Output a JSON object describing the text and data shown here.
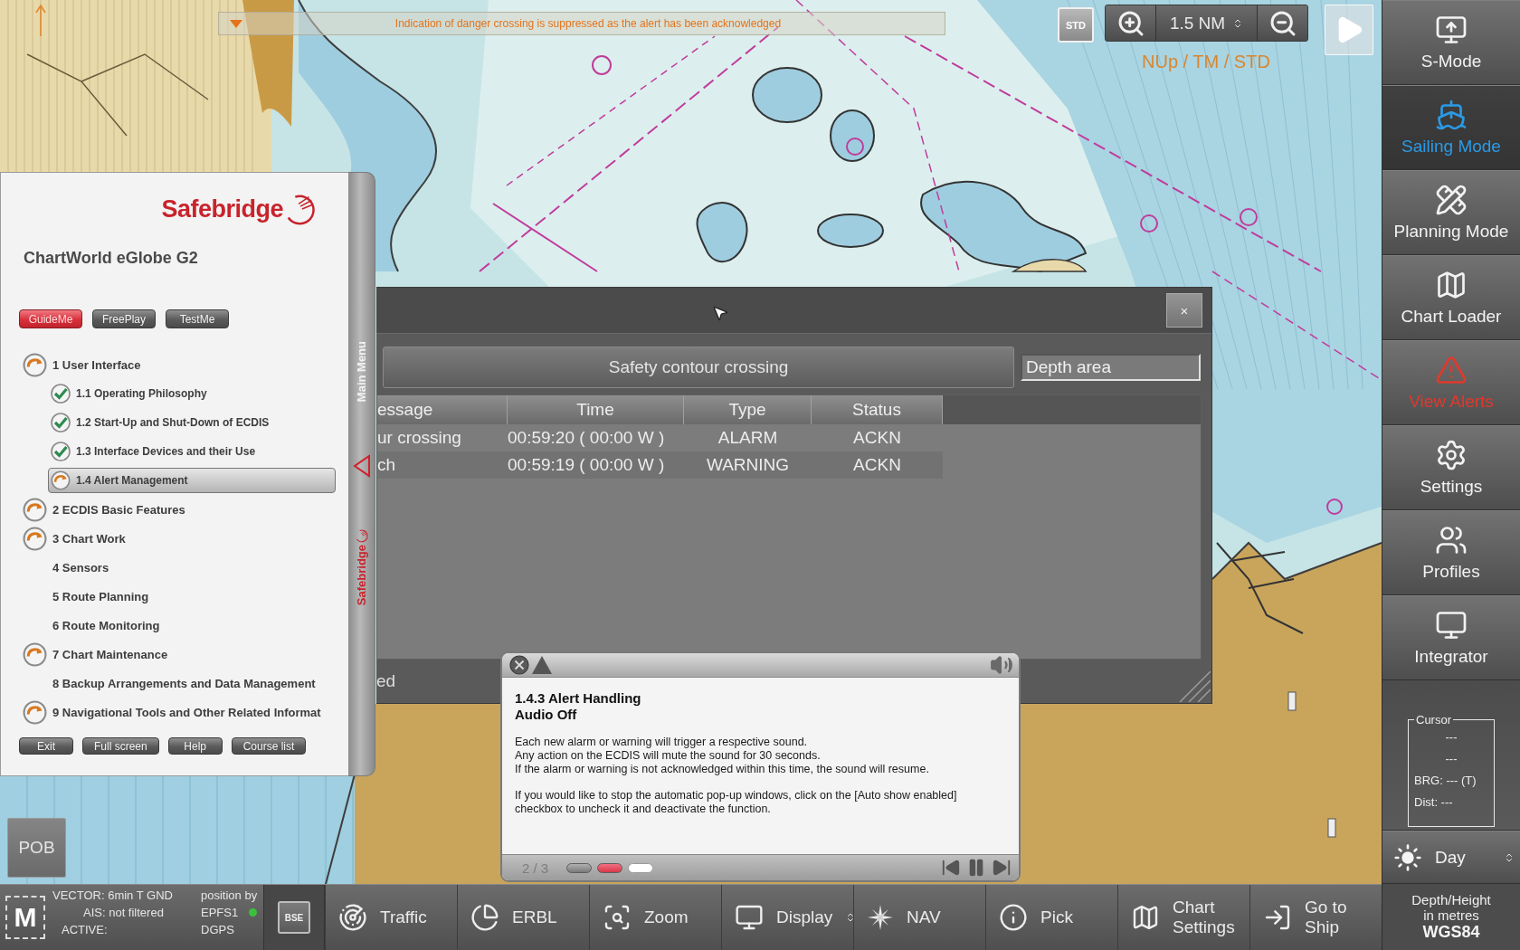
{
  "chart": {
    "banner": {
      "text": "Indication of danger crossing is suppressed as the alert has been acknowledged"
    },
    "std_button": {
      "label": "STD"
    },
    "range": {
      "value": "1.5 NM"
    },
    "orientation": "NUp / TM / STD",
    "pob_button": {
      "label": "POB"
    }
  },
  "sidebar": {
    "items": [
      {
        "label": "S-Mode",
        "selected": false,
        "alert": false
      },
      {
        "label": "Sailing Mode",
        "selected": true,
        "alert": false
      },
      {
        "label": "Planning Mode",
        "selected": false,
        "alert": false
      },
      {
        "label": "Chart Loader",
        "selected": false,
        "alert": false
      },
      {
        "label": "View Alerts",
        "selected": false,
        "alert": true
      },
      {
        "label": "Settings",
        "selected": false,
        "alert": false
      },
      {
        "label": "Profiles",
        "selected": false,
        "alert": false
      },
      {
        "label": "Integrator",
        "selected": false,
        "alert": false
      }
    ],
    "cursor": {
      "legend": "Cursor",
      "position": [
        "---",
        "---"
      ],
      "readouts": [
        "BRG: --- (T)",
        "Dist: ---"
      ]
    },
    "day_mode": {
      "value": "Day"
    },
    "datum": {
      "lines": [
        "Depth/Height",
        "in metres"
      ],
      "name": "WGS84"
    }
  },
  "course_panel": {
    "brand": "Safebridge",
    "product": "ChartWorld eGlobe G2",
    "modes": [
      {
        "label": "GuideMe",
        "selected": true
      },
      {
        "label": "FreePlay",
        "selected": false
      },
      {
        "label": "TestMe",
        "selected": false
      }
    ],
    "chapters": [
      {
        "label": "1 User Interface",
        "kind": "started",
        "selected": false,
        "children": [
          {
            "label": "1.1 Operating Philosophy",
            "kind": "completed",
            "selected": false
          },
          {
            "label": "1.2 Start-Up and Shut-Down of ECDIS",
            "kind": "completed",
            "selected": false
          },
          {
            "label": "1.3 Interface Devices and their Use",
            "kind": "completed",
            "selected": false
          },
          {
            "label": "1.4 Alert Management",
            "kind": "started",
            "selected": true
          }
        ]
      },
      {
        "label": "2 ECDIS Basic Features",
        "kind": "started",
        "selected": false
      },
      {
        "label": "3 Chart Work",
        "kind": "started",
        "selected": false
      },
      {
        "label": "4 Sensors",
        "kind": "unstarted",
        "selected": false
      },
      {
        "label": "5 Route Planning",
        "kind": "unstarted",
        "selected": false
      },
      {
        "label": "6 Route Monitoring",
        "kind": "unstarted",
        "selected": false
      },
      {
        "label": "7 Chart Maintenance",
        "kind": "started",
        "selected": false
      },
      {
        "label": "8 Backup Arrangements and Data Management",
        "kind": "unstarted",
        "selected": false
      },
      {
        "label": "9 Navigational Tools and Other Related Informat",
        "kind": "started",
        "selected": false
      }
    ],
    "buttons": [
      "Exit",
      "Full screen",
      "Help",
      "Course list"
    ],
    "side_tab": {
      "label": "Main Menu",
      "brand": "Safebridge"
    }
  },
  "alert_dialog": {
    "close_label": "×",
    "alert_button": "Safety contour crossing",
    "category_field": {
      "value": "Depth area"
    },
    "columns": [
      "essage",
      "Time",
      "Type",
      "Status"
    ],
    "rows": [
      [
        "ur crossing",
        "00:59:20 ( 00:00 W )",
        "ALARM",
        "ACKN"
      ],
      [
        "ch",
        "00:59:19 ( 00:00 W )",
        "WARNING",
        "ACKN"
      ]
    ],
    "footer": "ed"
  },
  "lesson_popup": {
    "title": "1.4.3 Alert Handling",
    "subtitle": "Audio Off",
    "paragraphs": [
      "Each new alarm or warning will trigger a respective sound.\nAny action on the ECDIS will mute the sound for 30 seconds.\nIf the alarm or warning is not acknowledged within this time, the sound will resume.",
      "If you would like to stop the automatic pop-up windows, click on the [Auto show enabled]\ncheckbox to uncheck it and deactivate the function."
    ],
    "page": "2 / 3",
    "steps": [
      {
        "visited": true,
        "selected": false
      },
      {
        "visited": true,
        "selected": true
      },
      {
        "visited": false,
        "selected": false
      }
    ]
  },
  "status_bar": {
    "mode_button": "M",
    "vector": [
      "VECTOR: 6min T GND",
      "AIS: not filtered",
      "ACTIVE:"
    ],
    "position": {
      "label": "position by",
      "sensor": {
        "name": "EPFS1",
        "color": "#3cc03c"
      },
      "fix": "DGPS"
    },
    "bse_button": "BSE",
    "buttons": [
      {
        "label": "Traffic",
        "kind": "button"
      },
      {
        "label": "ERBL",
        "kind": "button"
      },
      {
        "label": "Zoom",
        "kind": "button"
      },
      {
        "label": "Display",
        "kind": "selector"
      },
      {
        "label": "NAV",
        "kind": "button"
      },
      {
        "label": "Pick",
        "kind": "button"
      },
      {
        "label": "Chart Settings",
        "kind": "button"
      },
      {
        "label": "Go to Ship",
        "kind": "button"
      }
    ]
  }
}
